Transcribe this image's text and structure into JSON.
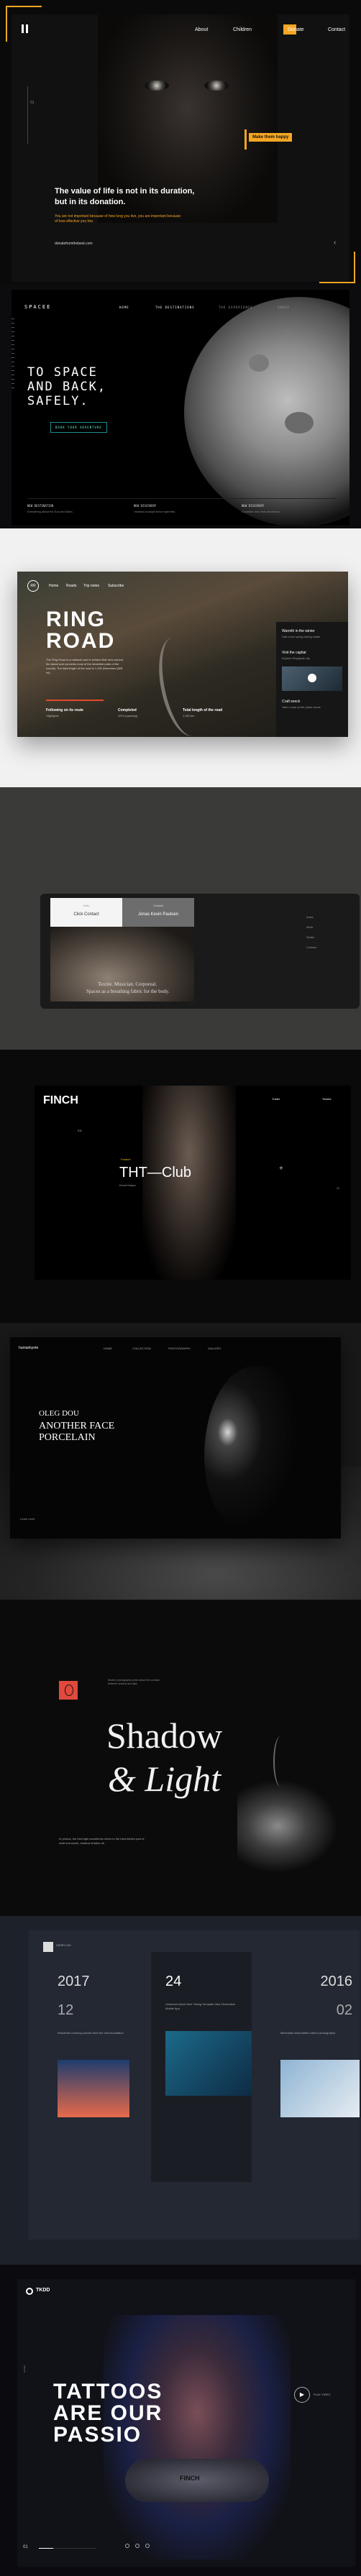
{
  "s1": {
    "nav": [
      "About",
      "Children",
      "Donate",
      "Contact"
    ],
    "badge": "Make them happy",
    "headline1": "The value of life is not in its duration,",
    "headline2": "but in its donation.",
    "body": "You are not important because of how long you live, you are important because of how effective you live.",
    "link": "donatefromthebest.com",
    "side_num": "01",
    "accent": "#f5a623"
  },
  "s2": {
    "brand": "SPACEE",
    "nav": [
      "HOME",
      "THE DESTINATIONS",
      "THE EXPERIENCE",
      "ABOUT"
    ],
    "title": [
      "TO SPACE",
      "AND BACK,",
      "SAFELY."
    ],
    "cta": "BOOK YOUR ADVENTURE",
    "footer_heads": [
      "NEW DESTINATION",
      "NEW DISCOVERY",
      "NEW DISCOVERY"
    ],
    "footer_texts": [
      "Everything about the Sun and Mars",
      "Vivamus suscipit tortor eget felis",
      "Curabitur arcu erat accumsan"
    ]
  },
  "s3": {
    "nav": [
      "Home",
      "Roads",
      "Trip notes",
      "Subscribe"
    ],
    "logo": "RR",
    "title1": "RING",
    "title2": "ROAD",
    "body": "The Ring Road is a national road in Iceland that runs around the island and connects most of the inhabited parts of the country. The total length of the road is 1,332 kilometres (828 mi).",
    "cols": [
      {
        "h": "Following on its route",
        "t": "Highlights"
      },
      {
        "h": "Completed",
        "t": "1974 (opening)"
      },
      {
        "h": "Total length of the road",
        "t": "1,332 km"
      }
    ],
    "side": [
      {
        "h": "Warmth in the winter",
        "t": "Visit a hot spring during winter"
      },
      {
        "h": "Visit the capital",
        "t": "Explore Reykjavik city"
      },
      {
        "h": "Craft wreck",
        "t": "Take a look at the plane wreck"
      }
    ]
  },
  "s4": {
    "card1": "Click Contact",
    "card2": "Jonas Kevin Paulsen",
    "label1": "Hello",
    "label2": "Contact",
    "tagline1": "Textile. Musician. Corporeal.",
    "tagline2": "Spaces as a breathing fabric for the body.",
    "side": [
      "Index",
      "Work",
      "Studio",
      "Contact"
    ]
  },
  "s5": {
    "brand": "FINCH",
    "nav": [
      "Trailer",
      "Tickets"
    ],
    "lang": "EN",
    "title": "THT—Club",
    "sub1": "Feature",
    "sub2": "Kevin Keanu",
    "side_num": "02"
  },
  "s6": {
    "brand": "humankyote",
    "nav": [
      "HOME",
      "COLLECTION",
      "PHOTOGRAPHY",
      "GALLERY"
    ],
    "name": "OLEG DOU",
    "title1": "ANOTHER FACE",
    "title2": "PORCELAIN",
    "cta": "Learn more"
  },
  "s7": {
    "t1": "Shadow",
    "t2": "& Light",
    "caption": "Modern photography series about the contrast between shadow and light",
    "body": "In photos, the best light sometimes refers to the best hidden part of what surrounds, shadow shades all.",
    "accent": "#e0493c"
  },
  "s8": {
    "brand": "WEBFLOW",
    "cols": [
      {
        "year": "2017",
        "num": "12",
        "title": "Wonderful morning sunrise from the new foundation",
        "colors": [
          "#1e3c6e",
          "#e76a4b"
        ]
      },
      {
        "year": "",
        "num": "24",
        "title": "Universal Quick Note Taking Template Idea Generation Mobile App",
        "colors": [
          "#1b6a8a",
          "#0e2b44"
        ]
      },
      {
        "year": "2016",
        "num": "02",
        "title": "Minimalist minimalistic interior photography",
        "colors": [
          "#8eb4d3",
          "#e6ecf2"
        ]
      }
    ]
  },
  "s9": {
    "brand": "TKDD",
    "title": [
      "TATTOOS",
      "ARE OUR",
      "PASSIO"
    ],
    "play": "PLAY VIDEO",
    "side": "Menu",
    "counter": "01",
    "tattoo": "FINCH"
  }
}
